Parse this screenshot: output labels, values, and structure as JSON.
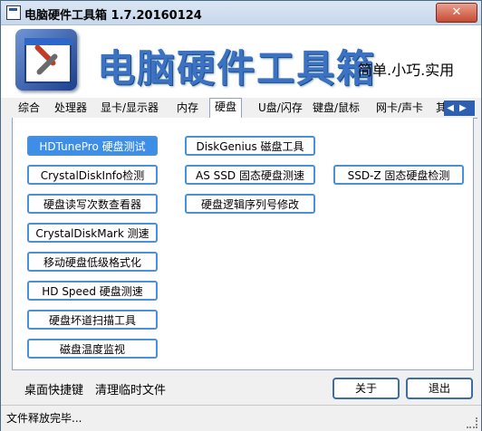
{
  "window": {
    "title": "电脑硬件工具箱 1.7.20160124",
    "close_label": "✕"
  },
  "banner": {
    "app_name": "电脑硬件工具箱",
    "slogan": "简单.小巧.实用"
  },
  "tabs": [
    {
      "label": "综合"
    },
    {
      "label": "处理器"
    },
    {
      "label": "显卡/显示器"
    },
    {
      "label": "内存"
    },
    {
      "label": "硬盘",
      "active": true
    },
    {
      "label": "U盘/闪存"
    },
    {
      "label": "键盘/鼠标"
    },
    {
      "label": "网卡/声卡"
    },
    {
      "label": "其"
    }
  ],
  "tab_scroll": {
    "left": "◀",
    "right": "▶"
  },
  "tools": {
    "col1": [
      {
        "label": "HDTunePro 硬盘测试",
        "selected": true
      },
      {
        "label": "CrystalDiskInfo检测"
      },
      {
        "label": "硬盘读写次数查看器"
      },
      {
        "label": "CrystalDiskMark 测速"
      },
      {
        "label": "移动硬盘低级格式化"
      },
      {
        "label": "HD Speed 硬盘测速"
      },
      {
        "label": "硬盘坏道扫描工具"
      },
      {
        "label": "磁盘温度监视"
      }
    ],
    "col2": [
      {
        "label": "DiskGenius 磁盘工具"
      },
      {
        "label": "AS SSD 固态硬盘测速"
      },
      {
        "label": "硬盘逻辑序列号修改"
      }
    ],
    "col3": [
      {
        "label": "SSD-Z 固态硬盘检测"
      }
    ]
  },
  "footer": {
    "desktop_shortcut": "桌面快捷键",
    "clean_temp": "清理临时文件",
    "about": "关于",
    "exit": "退出"
  },
  "status": {
    "text": "文件释放完毕..."
  }
}
